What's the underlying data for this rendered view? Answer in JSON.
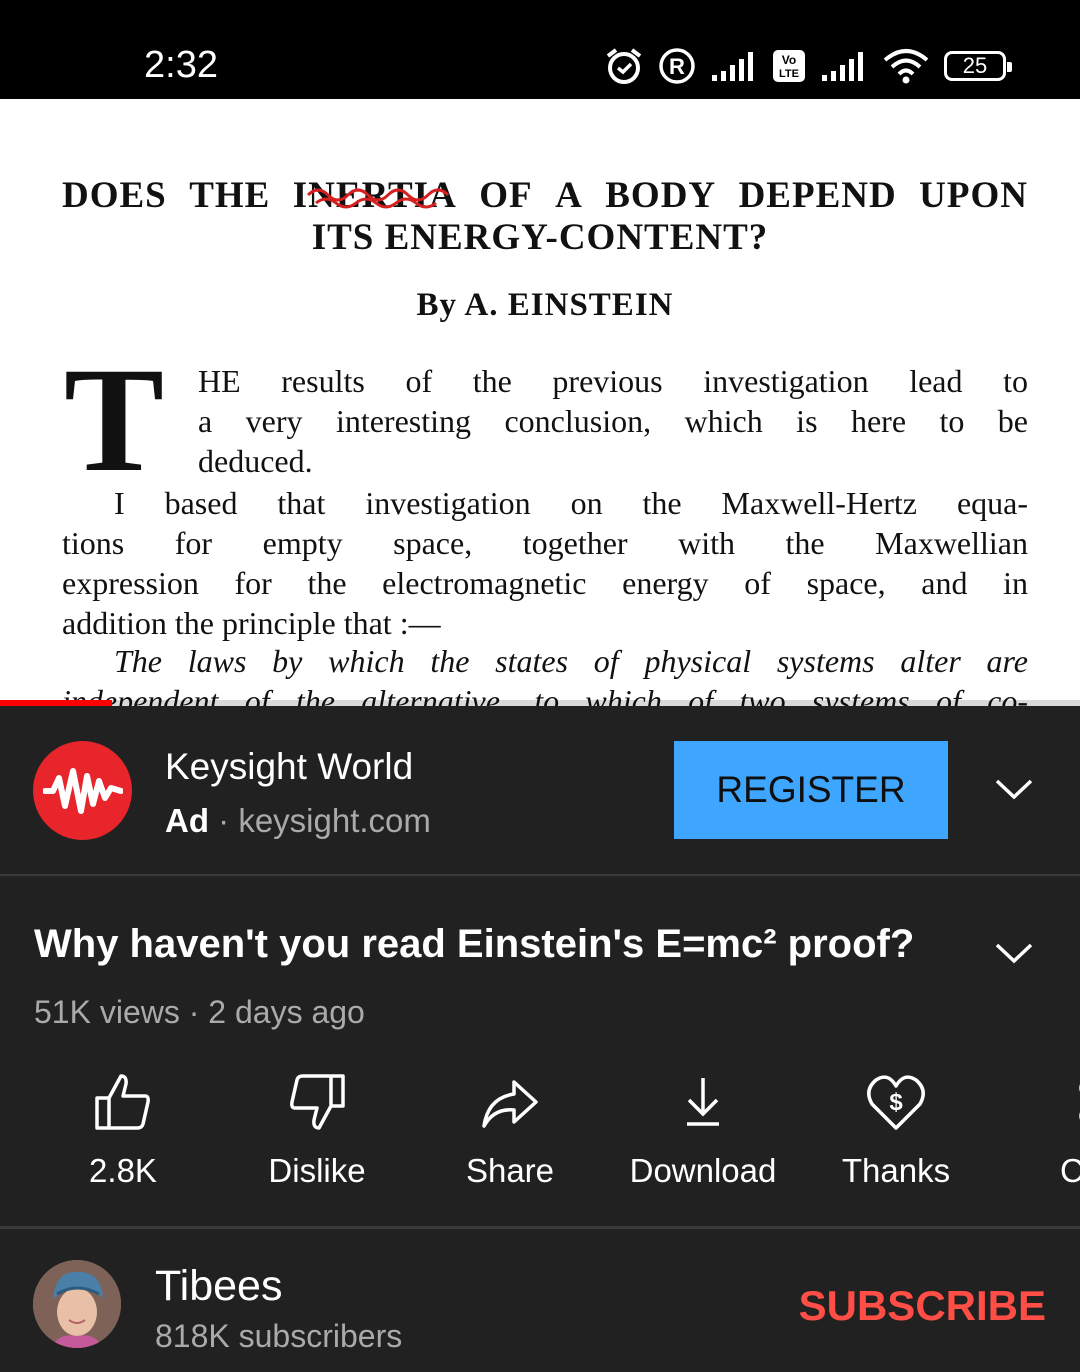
{
  "status": {
    "time": "2:32",
    "battery": "25"
  },
  "paper": {
    "title_line1_words": [
      "DOES",
      "THE",
      "INERTIA",
      "OF",
      "A",
      "BODY",
      "DEPEND",
      "UPON"
    ],
    "title_line2": "ITS ENERGY-CONTENT?",
    "byline": "By A. EINSTEIN",
    "dropcap": "T",
    "p1_lines": [
      "HE results of the previous investigation lead to",
      "a very interesting conclusion, which is here to be",
      "deduced."
    ],
    "p2_lines": [
      "I based that investigation on the Maxwell-Hertz equa-",
      "tions for empty space, together with the Maxwellian",
      "expression for the electromagnetic energy of space, and in",
      "addition the principle that :—"
    ],
    "p3_lines": [
      "The laws by which the states of physical systems alter are",
      "independent of the alternative, to which of two systems of co-"
    ]
  },
  "ad": {
    "name": "Keysight World",
    "label": "Ad",
    "domain": "keysight.com",
    "cta": "REGISTER",
    "logo_color": "#e8252a",
    "cta_color": "#3ea6ff"
  },
  "video": {
    "title": "Why haven't you read Einstein's E=mc² proof?",
    "views": "51K views",
    "age": "2 days ago"
  },
  "actions": [
    {
      "icon": "thumbs-up-icon",
      "label": "2.8K"
    },
    {
      "icon": "thumbs-down-icon",
      "label": "Dislike"
    },
    {
      "icon": "share-icon",
      "label": "Share"
    },
    {
      "icon": "download-icon",
      "label": "Download"
    },
    {
      "icon": "thanks-icon",
      "label": "Thanks"
    },
    {
      "icon": "clip-icon",
      "label": "C"
    }
  ],
  "channel": {
    "name": "Tibees",
    "subscribers": "818K subscribers",
    "subscribe": "SUBSCRIBE",
    "subscribe_color": "#ff4e45"
  },
  "playback": {
    "progress_fraction": 0.104
  }
}
